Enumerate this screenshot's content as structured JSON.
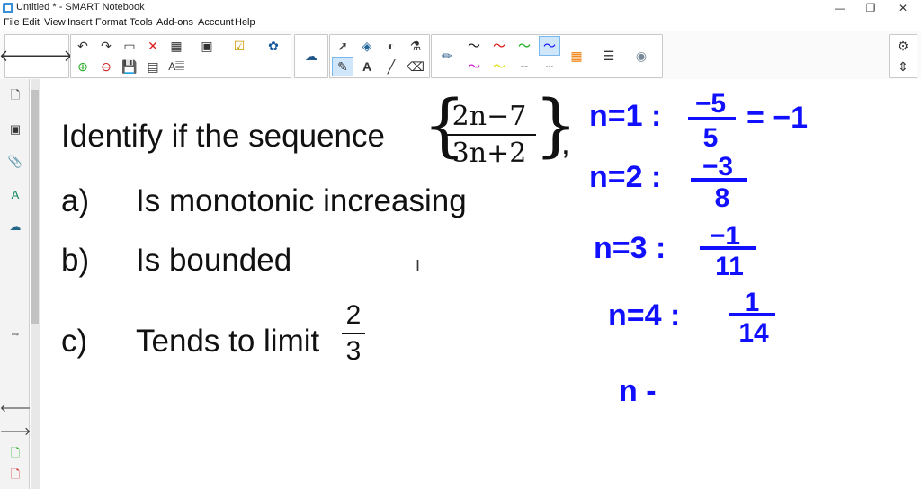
{
  "window": {
    "title": "Untitled * - SMART Notebook"
  },
  "menu": [
    "File",
    "Edit",
    "View",
    "Insert",
    "Format",
    "Tools",
    "Add-ons",
    "Account",
    "Help"
  ],
  "question": {
    "title": "Identify if the sequence",
    "numerator": "2n−7",
    "denominator": "3n+2",
    "trailing": ",",
    "items": [
      {
        "label": "a)",
        "text": "Is monotonic increasing"
      },
      {
        "label": "b)",
        "text": "Is bounded"
      },
      {
        "label": "c)",
        "text": "Tends to limit",
        "frac_num": "2",
        "frac_den": "3"
      }
    ]
  },
  "handwriting": {
    "color": "#1010ff",
    "lines": [
      {
        "lhs": "n=1 :",
        "num": "−5",
        "den": "5",
        "rhs": "= −1"
      },
      {
        "lhs": "n=2 :",
        "num": "−3",
        "den": "8"
      },
      {
        "lhs": "n=3 :",
        "num": "−1",
        "den": "11"
      },
      {
        "lhs": "n=4 :",
        "num": "1",
        "den": "14"
      },
      {
        "lhs": "n -"
      }
    ]
  }
}
